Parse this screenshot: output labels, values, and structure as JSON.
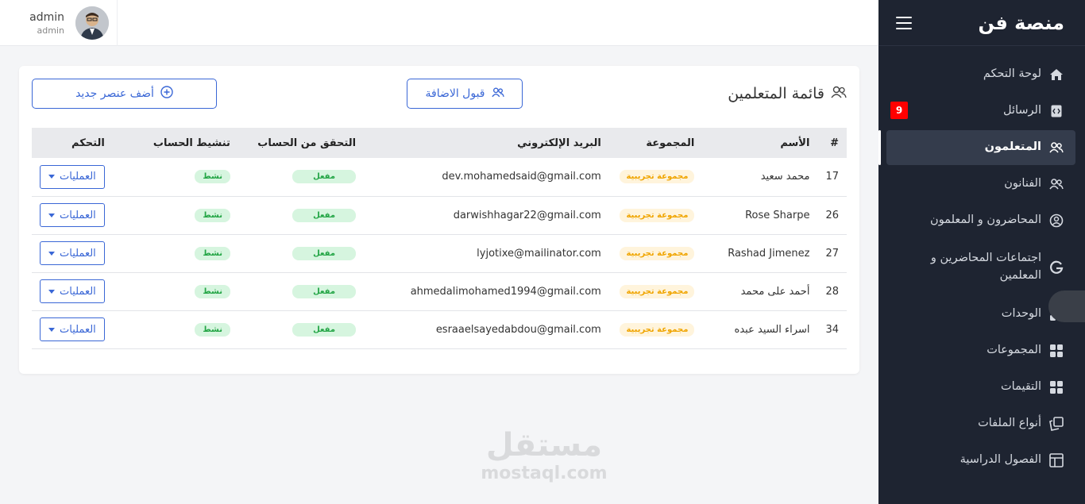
{
  "sidebar": {
    "brand": "منصة فن",
    "messages_badge": "9",
    "items": [
      {
        "label": "لوحة التحكم",
        "icon": "home-icon"
      },
      {
        "label": "الرسائل",
        "icon": "code-file-icon"
      },
      {
        "label": "المتعلمون",
        "icon": "users-icon"
      },
      {
        "label": "الفنانون",
        "icon": "users-icon"
      },
      {
        "label": "المحاضرون و المعلمون",
        "icon": "user-circle-icon"
      },
      {
        "label": "اجتماعات المحاضرين و المعلمين",
        "icon": "google-icon"
      },
      {
        "label": "الوحدات",
        "icon": "grid-icon"
      },
      {
        "label": "المجموعات",
        "icon": "grid-icon"
      },
      {
        "label": "التقيمات",
        "icon": "grid-icon"
      },
      {
        "label": "أنواع الملفات",
        "icon": "files-icon"
      },
      {
        "label": "الفصول الدراسية",
        "icon": "layout-icon"
      }
    ]
  },
  "topbar": {
    "user_name": "admin",
    "user_role": "admin"
  },
  "card": {
    "title": "قائمة المتعلمين",
    "accept_button": "قبول الاضافة",
    "add_button": "أضف عنصر جديد"
  },
  "table": {
    "headers": [
      "#",
      "الأسم",
      "المجموعة",
      "البريد الإلكتروني",
      "التحقق من الحساب",
      "تنشيط الحساب",
      "التحكم"
    ],
    "rows": [
      {
        "id": "17",
        "name": "محمد سعيد",
        "group": "مجموعة تجريبية",
        "email": "dev.mohamedsaid@gmail.com",
        "verified": "مفعل",
        "active": "نشط",
        "ops": "العمليات"
      },
      {
        "id": "26",
        "name": "Rose Sharpe",
        "group": "مجموعة تجريبية",
        "email": "darwishhagar22@gmail.com",
        "verified": "مفعل",
        "active": "نشط",
        "ops": "العمليات"
      },
      {
        "id": "27",
        "name": "Rashad Jimenez",
        "group": "مجموعة تجريبية",
        "email": "lyjotixe@mailinator.com",
        "verified": "مفعل",
        "active": "نشط",
        "ops": "العمليات"
      },
      {
        "id": "28",
        "name": "أحمد على محمد",
        "group": "مجموعة تجريبية",
        "email": "ahmedalimohamed1994@gmail.com",
        "verified": "مفعل",
        "active": "نشط",
        "ops": "العمليات"
      },
      {
        "id": "34",
        "name": "اسراء السيد عبده",
        "group": "مجموعة تجريبية",
        "email": "esraaelsayedabdou@gmail.com",
        "verified": "مفعل",
        "active": "نشط",
        "ops": "العمليات"
      }
    ]
  },
  "watermark": {
    "arabic": "مستقل",
    "latin": "mostaql.com"
  }
}
